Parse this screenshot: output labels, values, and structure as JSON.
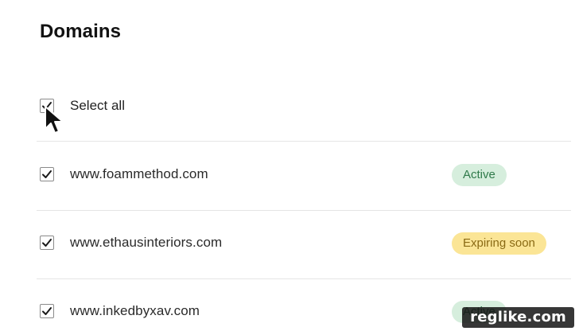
{
  "page": {
    "title": "Domains"
  },
  "select_all": {
    "label": "Select all",
    "checked": true
  },
  "domains": [
    {
      "name": "www.foammethod.com",
      "status": "Active",
      "checked": true
    },
    {
      "name": "www.ethausinteriors.com",
      "status": "Expiring soon",
      "checked": true
    },
    {
      "name": "www.inkedbyxav.com",
      "status": "Active",
      "checked": true
    }
  ],
  "colors": {
    "active_bg": "#d6eedd",
    "active_text": "#2f7a4a",
    "expiring_bg": "#fbe596",
    "expiring_text": "#8a6a14",
    "divider": "#e5e5e5"
  },
  "watermark": {
    "text": "reglike.com"
  },
  "icons": {
    "checkbox": "checkmark-icon",
    "cursor": "mouse-pointer-icon"
  }
}
